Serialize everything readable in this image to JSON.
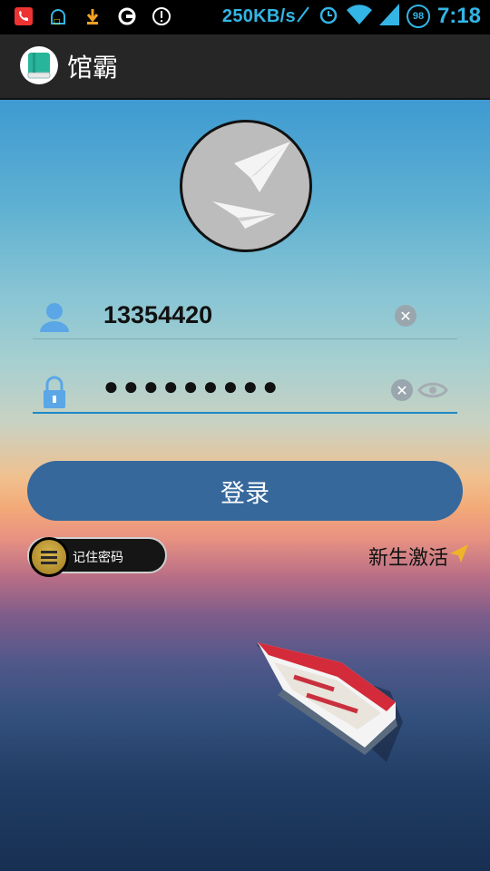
{
  "status_bar": {
    "net_speed": "250KB/s",
    "battery_level": "98",
    "time": "7:18",
    "icons": [
      "missed-call-icon",
      "android-debug-icon",
      "download-icon",
      "sync-icon",
      "alert-icon",
      "no-signal-icon",
      "alarm-icon",
      "wifi-icon",
      "signal-icon",
      "battery-icon"
    ]
  },
  "app_bar": {
    "title": "馆霸",
    "icon": "book-icon"
  },
  "login": {
    "username_value": "13354420",
    "password_masked": "●●●●●●●●●",
    "submit_label": "登录",
    "remember_label": "记住密码",
    "remember_checked": false,
    "activate_label": "新生激活"
  },
  "colors": {
    "accent": "#33b5e5",
    "button": "#36689c",
    "app_bar": "#262626"
  }
}
